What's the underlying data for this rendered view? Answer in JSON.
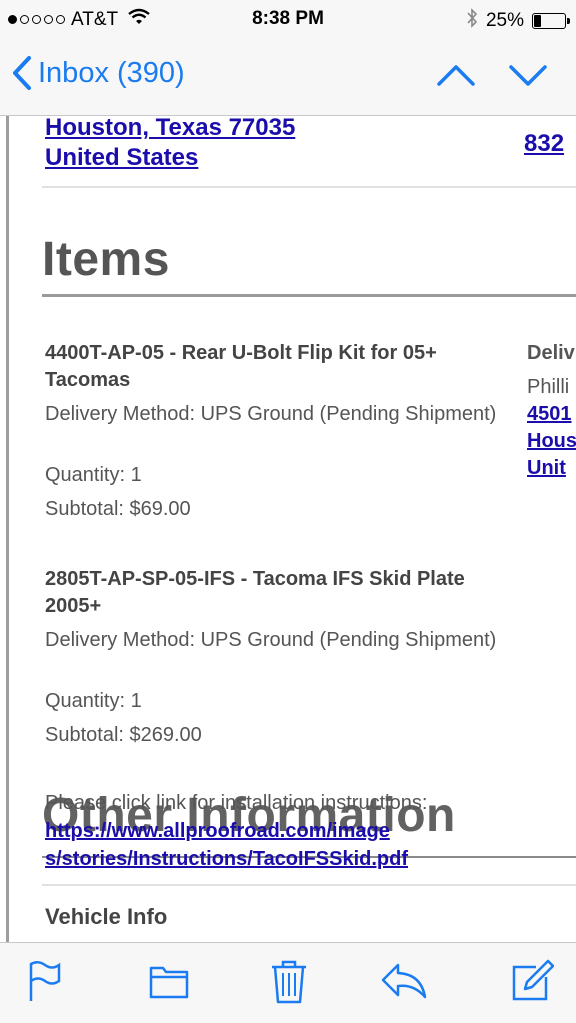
{
  "status": {
    "carrier": "AT&T",
    "time": "8:38 PM",
    "battery": "25%",
    "battery_level": 0.25
  },
  "nav": {
    "back_label": "Inbox (390)"
  },
  "address": {
    "line1": "Houston, Texas 77035",
    "line2": "United States",
    "phone_partial": "832"
  },
  "items_section": {
    "title": "Items",
    "side_heading_partial": "Deliv",
    "side_name_partial": "Philli",
    "side_address_partial": [
      "4501",
      "Hous",
      "Unit"
    ],
    "items": [
      {
        "name": "4400T-AP-05 - Rear U-Bolt Flip Kit for 05+ Tacomas",
        "delivery": "Delivery Method: UPS Ground (Pending Shipment)",
        "quantity": "Quantity: 1",
        "subtotal": "Subtotal: $69.00"
      },
      {
        "name": "2805T-AP-SP-05-IFS - Tacoma IFS Skid Plate 2005+",
        "delivery": "Delivery Method: UPS Ground (Pending Shipment)",
        "quantity": "Quantity: 1",
        "subtotal": "Subtotal: $269.00"
      }
    ]
  },
  "instructions": {
    "prompt": "Please click link for installation instructions:",
    "link_line1": "https://www.allproofroad.com/image",
    "link_line2": "s/stories/Instructions/TacoIFSSkid.pdf"
  },
  "other_section": {
    "title": "Other Information",
    "vehicle_heading": "Vehicle Info"
  },
  "toolbar": {
    "icons": [
      "flag-icon",
      "folder-icon",
      "trash-icon",
      "reply-icon",
      "compose-icon"
    ]
  },
  "colors": {
    "ios_blue": "#1a7cf0",
    "link_blue": "#1a0dab",
    "heading_gray": "#555555"
  }
}
